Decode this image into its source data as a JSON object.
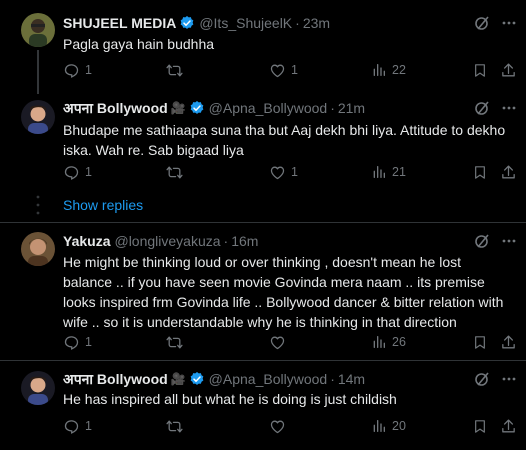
{
  "replies": [
    {
      "name": "SHUJEEL MEDIA",
      "badge": "",
      "handle": "@Its_ShujeelK",
      "time": "23m",
      "text": "Pagla gaya hain budhha",
      "stats": {
        "replies": "1",
        "reposts": "",
        "likes": "1",
        "views": "22"
      }
    },
    {
      "name": "अपना Bollywood",
      "badge": "🎥",
      "handle": "@Apna_Bollywood",
      "time": "21m",
      "text": "Bhudape me sathiaapa suna tha but Aaj dekh bhi liya. Attitude to dekho iska. Wah re. Sab bigaad liya",
      "stats": {
        "replies": "1",
        "reposts": "",
        "likes": "1",
        "views": "21"
      }
    },
    {
      "name": "Yakuza",
      "badge": "",
      "handle": "@longliveyakuza",
      "time": "16m",
      "text": "He might be thinking loud or over thinking , doesn't mean he lost balance .. if you have seen movie Govinda mera naam .. its premise looks inspired frm Govinda life .. Bollywood dancer & bitter relation with wife .. so it is understandable why he is thinking in that direction",
      "stats": {
        "replies": "1",
        "reposts": "",
        "likes": "",
        "views": "26"
      }
    },
    {
      "name": "अपना Bollywood",
      "badge": "🎥",
      "handle": "@Apna_Bollywood",
      "time": "14m",
      "text": "He has inspired all but what he is doing is just childish",
      "stats": {
        "replies": "1",
        "reposts": "",
        "likes": "",
        "views": "20"
      }
    }
  ],
  "show_replies_label": "Show replies",
  "colors": {
    "background": "#000000",
    "text": "#e7e9ea",
    "muted": "#71767b",
    "accent": "#1d9bf0",
    "divider": "#2f3336"
  }
}
